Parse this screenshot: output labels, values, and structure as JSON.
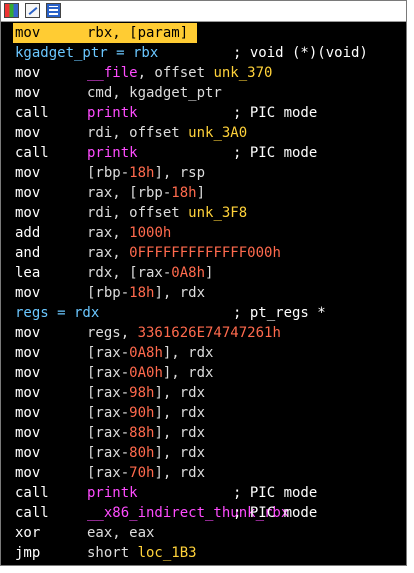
{
  "colors": {
    "background": "#000000",
    "highlight": "#ffcc33",
    "label": "#6bc7ff",
    "symbol": "#ff4cff",
    "location": "#ffd23a",
    "number": "#ff6a4d"
  },
  "toolbar": {
    "icons": [
      "graph-view-icon",
      "edit-icon",
      "hex-view-icon"
    ]
  },
  "lines": [
    {
      "op": "mov",
      "a": "rbx, [param]"
    },
    {
      "lbl": "kgadget_ptr = rbx",
      "cmt": "; void (*)(void)"
    },
    {
      "op": "mov",
      "sym": "__file",
      "a": ", offset ",
      "loc": "unk_370"
    },
    {
      "op": "mov",
      "a": "cmd, kgadget_ptr"
    },
    {
      "op": "call",
      "sym": "printk",
      "cmt": "; PIC mode"
    },
    {
      "op": "mov",
      "a": "rdi, offset ",
      "loc": "unk_3A0"
    },
    {
      "op": "call",
      "sym": "printk",
      "cmt": "; PIC mode"
    },
    {
      "op": "mov",
      "a1": "[rbp-",
      "n": "18h",
      "a2": "], rsp"
    },
    {
      "op": "mov",
      "a1": "rax, [rbp-",
      "n": "18h",
      "a2": "]"
    },
    {
      "op": "mov",
      "a": "rdi, offset ",
      "loc": "unk_3F8"
    },
    {
      "op": "add",
      "a1": "rax, ",
      "n": "1000h",
      "a2": ""
    },
    {
      "op": "and",
      "a1": "rax, ",
      "n": "0FFFFFFFFFFFFF000h",
      "a2": ""
    },
    {
      "op": "lea",
      "a1": "rdx, [rax-",
      "n": "0A8h",
      "a2": "]"
    },
    {
      "op": "mov",
      "a1": "[rbp-",
      "n": "18h",
      "a2": "], rdx"
    },
    {
      "lbl": "regs = rdx",
      "cmt": "; pt_regs *"
    },
    {
      "op": "mov",
      "a1": "regs, ",
      "n": "3361626E74747261h",
      "a2": ""
    },
    {
      "op": "mov",
      "a1": "[rax-",
      "n": "0A8h",
      "a2": "], rdx"
    },
    {
      "op": "mov",
      "a1": "[rax-",
      "n": "0A0h",
      "a2": "], rdx"
    },
    {
      "op": "mov",
      "a1": "[rax-",
      "n": "98h",
      "a2": "], rdx"
    },
    {
      "op": "mov",
      "a1": "[rax-",
      "n": "90h",
      "a2": "], rdx"
    },
    {
      "op": "mov",
      "a1": "[rax-",
      "n": "88h",
      "a2": "], rdx"
    },
    {
      "op": "mov",
      "a1": "[rax-",
      "n": "80h",
      "a2": "], rdx"
    },
    {
      "op": "mov",
      "a1": "[rax-",
      "n": "70h",
      "a2": "], rdx"
    },
    {
      "op": "call",
      "sym": "printk",
      "cmt": "; PIC mode"
    },
    {
      "op": "call",
      "sym": "__x86_indirect_thunk_rbx",
      "cmt": "; PIC mode"
    },
    {
      "op": "xor",
      "a": "eax, eax"
    },
    {
      "op": "jmp",
      "a": "short ",
      "loc": "loc_1B3"
    }
  ]
}
